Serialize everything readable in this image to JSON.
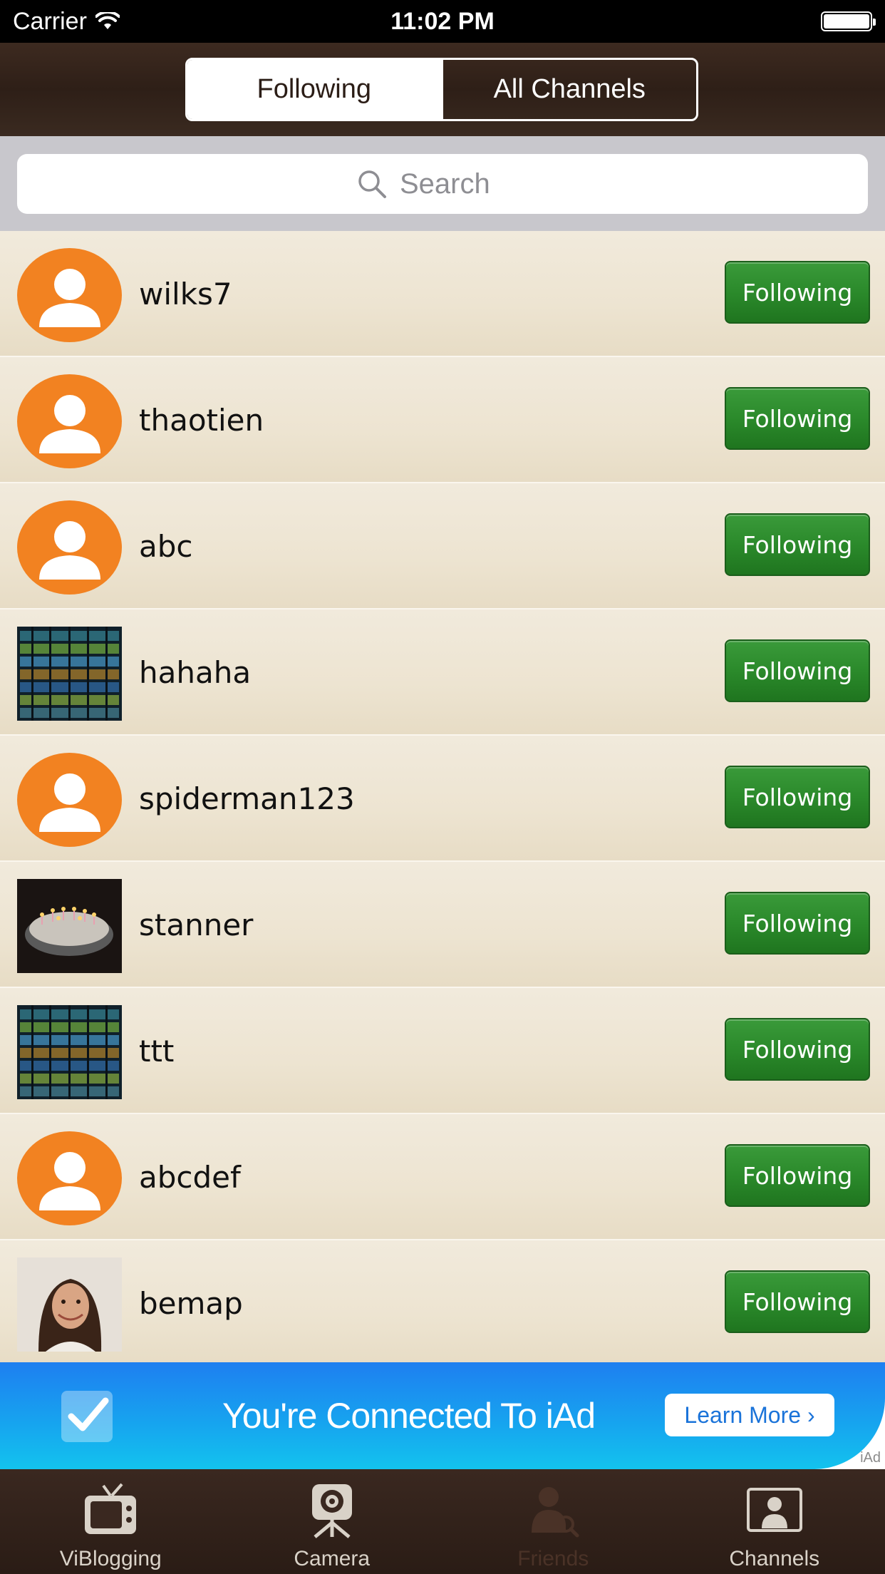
{
  "status_bar": {
    "carrier": "Carrier",
    "time": "11:02 PM"
  },
  "segmented": {
    "following": "Following",
    "all_channels": "All Channels"
  },
  "search": {
    "placeholder": "Search"
  },
  "rows": [
    {
      "username": "wilks7",
      "button": "Following",
      "avatar": "default-user-icon"
    },
    {
      "username": "thaotien",
      "button": "Following",
      "avatar": "default-user-icon"
    },
    {
      "username": "abc",
      "button": "Following",
      "avatar": "default-user-icon"
    },
    {
      "username": "hahaha",
      "button": "Following",
      "avatar": "photo-shelf"
    },
    {
      "username": "spiderman123",
      "button": "Following",
      "avatar": "default-user-icon"
    },
    {
      "username": "stanner",
      "button": "Following",
      "avatar": "photo-cake"
    },
    {
      "username": "ttt",
      "button": "Following",
      "avatar": "photo-shelf"
    },
    {
      "username": "abcdef",
      "button": "Following",
      "avatar": "default-user-icon"
    },
    {
      "username": "bemap",
      "button": "Following",
      "avatar": "photo-portrait"
    }
  ],
  "ad": {
    "title": "You're Connected To iAd",
    "button": "Learn More ›",
    "tag": "iAd"
  },
  "tabbar": {
    "items": [
      {
        "label": "ViBlogging",
        "icon": "tv-icon"
      },
      {
        "label": "Camera",
        "icon": "camera-icon"
      },
      {
        "label": "Friends",
        "icon": "friends-icon"
      },
      {
        "label": "Channels",
        "icon": "channels-icon"
      }
    ],
    "selected": "Friends"
  },
  "colors": {
    "accent_green": "#2b8a2b",
    "avatar_orange": "#f28221",
    "header_brown": "#2e1f17",
    "ad_blue": "#1e7ff0"
  }
}
